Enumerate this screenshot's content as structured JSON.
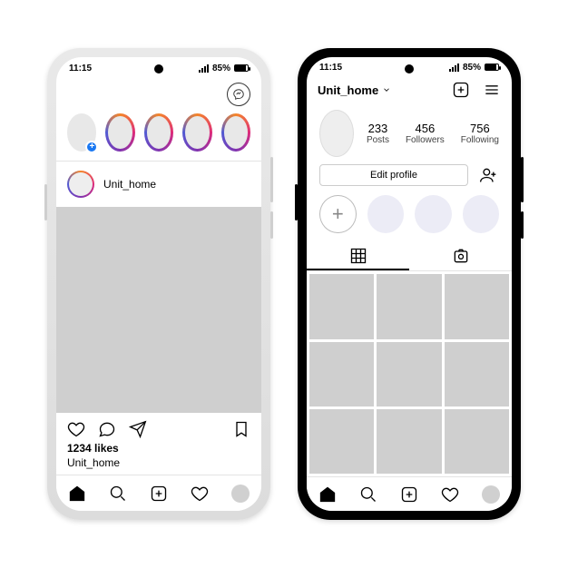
{
  "status": {
    "time": "11:15",
    "battery_pct": "85%"
  },
  "feed": {
    "username": "Unit_home",
    "likes_line": "1234 likes",
    "caption_user": "Unit_home"
  },
  "profile": {
    "username": "Unit_home",
    "posts": {
      "count": "233",
      "label": "Posts"
    },
    "followers": {
      "count": "456",
      "label": "Followers"
    },
    "following": {
      "count": "756",
      "label": "Following"
    },
    "edit_label": "Edit profile"
  }
}
